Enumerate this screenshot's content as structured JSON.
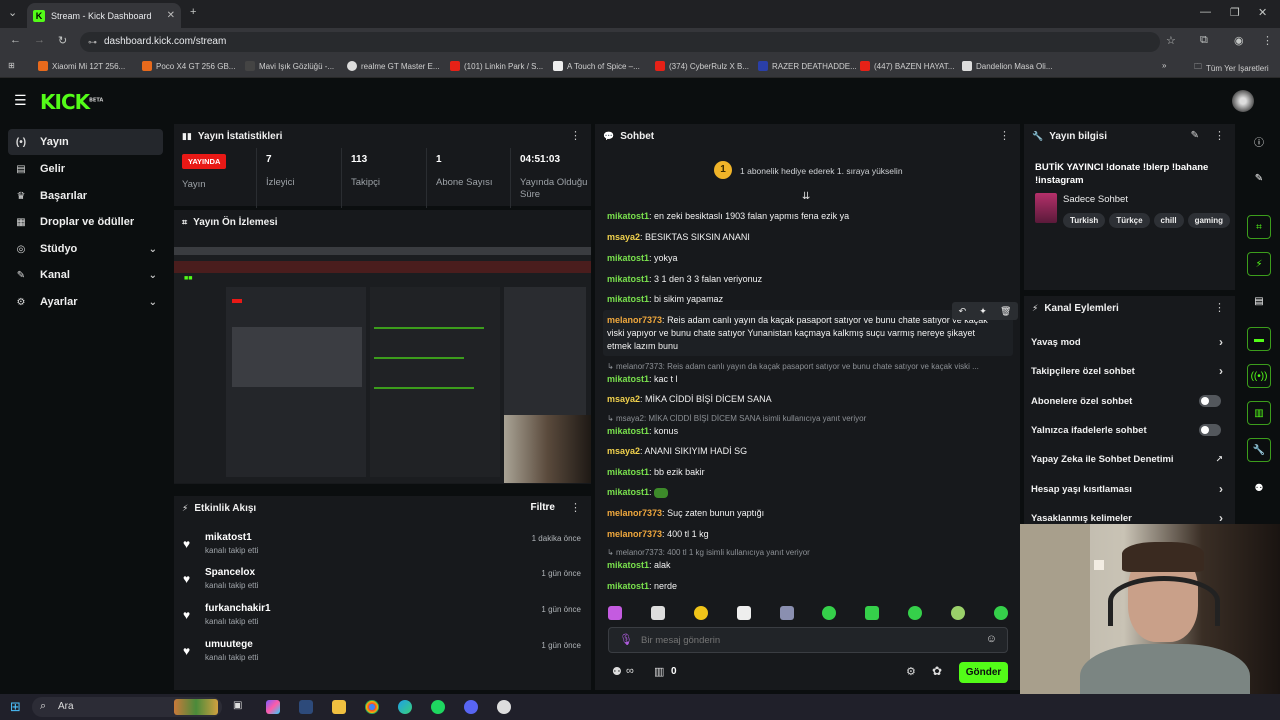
{
  "browser": {
    "tab_title": "Stream - Kick Dashboard",
    "url": "dashboard.kick.com/stream",
    "bookmarks": [
      "Xiaomi Mi 12T 256...",
      "Poco X4 GT 256 GB...",
      "Mavi Işık Gözlüğü -...",
      "realme GT Master E...",
      "(101) Linkin Park / S...",
      "A Touch of Spice –...",
      "(374) CyberRulz X B...",
      "RAZER DEATHADDE...",
      "(447) BAZEN HAYAT...",
      "Dandelion Masa Oli..."
    ],
    "bookmarks_all": "Tüm Yer İşaretleri"
  },
  "logo": {
    "text": "KICK",
    "beta": "BETA"
  },
  "sidebar": {
    "items": [
      {
        "label": "Yayın",
        "icon": "broadcast-icon"
      },
      {
        "label": "Gelir",
        "icon": "wallet-icon"
      },
      {
        "label": "Başarılar",
        "icon": "trophy-icon"
      },
      {
        "label": "Droplar ve ödüller",
        "icon": "gift-icon"
      },
      {
        "label": "Stüdyo",
        "icon": "studio-icon"
      },
      {
        "label": "Kanal",
        "icon": "channel-icon"
      },
      {
        "label": "Ayarlar",
        "icon": "gear-icon"
      }
    ]
  },
  "stats": {
    "title": "Yayın İstatistikleri",
    "live_badge": "YAYINDA",
    "live_label": "Yayın",
    "viewers": "7",
    "viewers_label": "İzleyici",
    "followers": "113",
    "followers_label": "Takipçi",
    "subs": "1",
    "subs_label": "Abone Sayısı",
    "uptime": "04:51:03",
    "uptime_label": "Yayında Olduğu Süre"
  },
  "preview": {
    "title": "Yayın Ön İzlemesi"
  },
  "activity": {
    "title": "Etkinlik Akışı",
    "filter": "Filtre",
    "items": [
      {
        "name": "mikatost1",
        "sub": "kanalı takip etti",
        "time": "1 dakika önce"
      },
      {
        "name": "Spancelox",
        "sub": "kanalı takip etti",
        "time": "1 gün önce"
      },
      {
        "name": "furkanchakir1",
        "sub": "kanalı takip etti",
        "time": "1 gün önce"
      },
      {
        "name": "umuutege",
        "sub": "kanalı takip etti",
        "time": "1 gün önce"
      }
    ]
  },
  "chat": {
    "title": "Sohbet",
    "gift_count": "1",
    "gift_text": "1 abonelik hediye ederek 1. sıraya yükselin",
    "messages": [
      {
        "user": "mikatost1",
        "text": "en zeki besiktaslı 1903 falan yapmıs fena ezik ya"
      },
      {
        "user": "msaya2",
        "text": "BESIKTAS SIKSIN ANANI"
      },
      {
        "user": "mikatost1",
        "text": "yokya"
      },
      {
        "user": "mikatost1",
        "text": "3 1 den 3 3 falan veriyonuz"
      },
      {
        "user": "mikatost1",
        "text": "bi sikim yapamaz"
      },
      {
        "user": "melanor7373",
        "text": "Reis adam canlı yayın da kaçak pasaport satıyor ve bunu chate satıyor ve kaçak viski yapıyor ve bunu chate satıyor Yunanistan kaçmaya kalkmış suçu varmış nereye şikayet etmek lazım bunu"
      },
      {
        "user": "mikatost1",
        "text": "kac t l"
      },
      {
        "user": "msaya2",
        "text": "MİKA CİDDİ BİŞİ DİCEM SANA"
      },
      {
        "user": "mikatost1",
        "text": "konus"
      },
      {
        "user": "msaya2",
        "text": "ANANI SIKIYIM HADİ SG"
      },
      {
        "user": "mikatost1",
        "text": "bb ezik bakir"
      },
      {
        "user": "mikatost1",
        "text": ""
      },
      {
        "user": "melanor7373",
        "text": "Suç zaten bunun yaptığı"
      },
      {
        "user": "melanor7373",
        "text": "400 tl 1 kg"
      },
      {
        "user": "mikatost1",
        "text": "alak"
      },
      {
        "user": "mikatost1",
        "text": "nerde"
      }
    ],
    "replies": [
      "melanor7373: Reis adam canlı yayın da kaçak pasaport satıyor ve bunu chate satıyor ve kaçak viski ...",
      "msaya2: MİKA CİDDİ BİŞİ DİCEM SANA isimli kullanıcıya yanıt veriyor",
      "melanor7373: 400 tl 1 kg isimli kullanıcıya yanıt veriyor"
    ],
    "placeholder": "Bir mesaj gönderin",
    "send": "Gönder",
    "count": "0",
    "infinity": "∞"
  },
  "info": {
    "title": "Yayın bilgisi",
    "stream_title": "BUTİK YAYINCI !donate !blerp !bahane !instagram",
    "category": "Sadece Sohbet",
    "tags": [
      "Turkish",
      "Türkçe",
      "chill",
      "gaming"
    ]
  },
  "actions": {
    "title": "Kanal Eylemleri",
    "rows": [
      {
        "label": "Yavaş mod",
        "kind": "arrow"
      },
      {
        "label": "Takipçilere özel sohbet",
        "kind": "arrow"
      },
      {
        "label": "Abonelere özel sohbet",
        "kind": "toggle"
      },
      {
        "label": "Yalnızca ifadelerle sohbet",
        "kind": "toggle"
      },
      {
        "label": "Yapay Zeka ile Sohbet Denetimi",
        "kind": "ext"
      },
      {
        "label": "Hesap yaşı kısıtlaması",
        "kind": "arrow"
      },
      {
        "label": "Yasaklanmış kelimeler",
        "kind": "arrow"
      }
    ]
  },
  "taskbar": {
    "search": "Ara"
  },
  "colors": {
    "accent": "#53fc18",
    "live": "#e91916",
    "panel": "#17191c"
  }
}
